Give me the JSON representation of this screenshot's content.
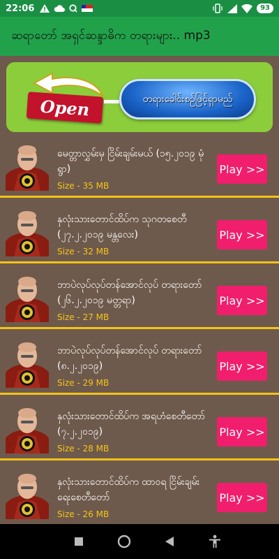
{
  "status_bar": {
    "time": "22:06",
    "left_icons": [
      "alert-icon",
      "cloud-icon",
      "q-icon",
      "flag-icon"
    ],
    "battery": "93"
  },
  "app_bar": {
    "title": "ဆရာတော် အရှင်ဆန္ဒာဓိက တရားများ.. mp3"
  },
  "banner": {
    "open_label": "Open",
    "pill_text": "တရားခေါင်းစဉ်ဖြင့်ရှာမည်"
  },
  "items": [
    {
      "title": "မေတ္တာလွှမ်းမှ ငြိမ်းချမ်းမယ် (၁၅.၂၀၁၉ မုံရွာ)",
      "size": "Size - 35 MB",
      "play": "Play >>"
    },
    {
      "title": "နှလုံးသားတောင်ထိပ်က သုဂတစေတီ (၂၇.၂.၂၀၁၉ မန္တလေး)",
      "size": "Size - 32 MB",
      "play": "Play >>"
    },
    {
      "title": "ဘာပဲလုပ်လုပ်တန်အောင်လုပ် တရားတော် (၂၆.၂.၂၀၁၉ မတ္တရာ)",
      "size": "Size - 27 MB",
      "play": "Play >>"
    },
    {
      "title": "ဘာပဲလုပ်လုပ်တန်အောင်လုပ် တရားတော် (၈.၂.၂၀၁၉)",
      "size": "Size - 29 MB",
      "play": "Play >>"
    },
    {
      "title": "နှလုံးသားတောင်ထိပ်က အရဟံစေတီတော် (၇.၂.၂၀၁၉)",
      "size": "Size - 28 MB",
      "play": "Play >>"
    },
    {
      "title": "နှလုံးသားတောင်ထိပ်က ထာဝရ ငြိမ်းချမ်းရေးစေတီတော်",
      "size": "Size - 26 MB",
      "play": "Play >>"
    }
  ],
  "nav_bar": {
    "icons": [
      "recents-square-icon",
      "home-circle-icon",
      "back-triangle-icon",
      "accessibility-icon"
    ]
  },
  "colors": {
    "status_bar": "#1a8f44",
    "app_bar": "#21a24a",
    "list_bg": "#6e5a4c",
    "divider": "#f2c318",
    "play_button": "#f01e6c",
    "size_text": "#f5c518",
    "banner_bg": "#8ccd3c"
  }
}
